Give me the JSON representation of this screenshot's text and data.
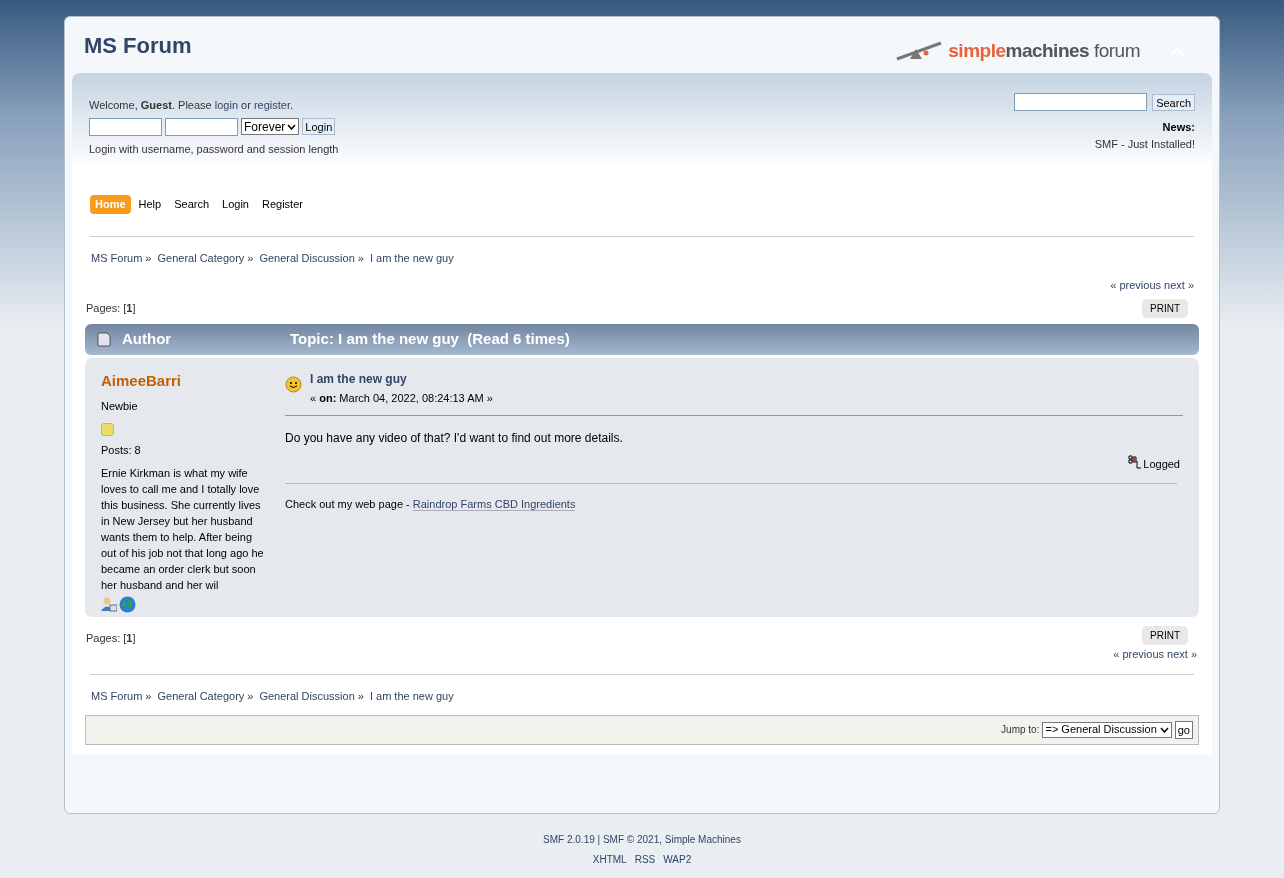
{
  "header": {
    "title": "MS Forum",
    "logo": {
      "part_1": "simple",
      "part_2": "machines",
      "part_3": "forum"
    }
  },
  "user_area": {
    "text_1": "Welcome, **Guest**. Please ",
    "login_link": "login",
    "text_2": " or ",
    "register_link": "register",
    "text_3": ".",
    "session_option": "Forever",
    "login_button": "Login",
    "hint": "Login with username, password and session length"
  },
  "search": {
    "button": "Search"
  },
  "news": {
    "label": "News:",
    "text": "SMF - Just Installed!"
  },
  "menu": [
    {
      "label": "Home",
      "selected": true
    },
    {
      "label": "Help",
      "selected": false
    },
    {
      "label": "Search",
      "selected": false
    },
    {
      "label": "Login",
      "selected": false
    },
    {
      "label": "Register",
      "selected": false
    }
  ],
  "breadcrumbs_top": {
    "items": [
      "MS Forum",
      "General Category",
      "General Discussion",
      "I am the new guy"
    ],
    "separator": "»"
  },
  "nav_top": {
    "previous": "« previous",
    "next": "next »",
    "pages_label": "Pages: [",
    "current_page": "1",
    "pages_end": "]",
    "print": "PRINT"
  },
  "topic_header": {
    "author": "Author",
    "topic": "Topic: I am the new guy  (Read 6 times)"
  },
  "post": {
    "poster": "AimeeBarri",
    "group": "Newbie",
    "posts": "Posts: 8",
    "bio": "Ernie Kirkman is what my wife loves to call me and I totally love this business. She currently lives in New Jersey but her husband wants them to help. After being out of his job not that long ago he became an order clerk but soon her husband and her wil",
    "subject": "I am the new guy",
    "date": "« **on:** March 04, 2022, 08:24:13 AM »",
    "body": "Do you have any video of that? I'd want to find out more details.",
    "logged": "Logged",
    "signature_text": "Check out my web page - ",
    "signature_link": "Raindrop Farms CBD Ingredients"
  },
  "nav_bottom": {
    "pages_label": "Pages: [",
    "current_page": "1",
    "pages_end": "]",
    "print": "PRINT",
    "previous": "« previous",
    "next": "next »"
  },
  "breadcrumbs_bottom": {
    "items": [
      "MS Forum",
      "General Category",
      "General Discussion",
      "I am the new guy"
    ],
    "separator": "»"
  },
  "jump": {
    "label": "Jump to:",
    "selected_option": "=> General Discussion",
    "button": "go"
  },
  "footer": {
    "version_link": "SMF 2.0.19",
    "separator": "|",
    "copyright_link": "SMF © 2021, Simple Machines",
    "links": [
      "XHTML",
      "RSS",
      "WAP2"
    ]
  }
}
